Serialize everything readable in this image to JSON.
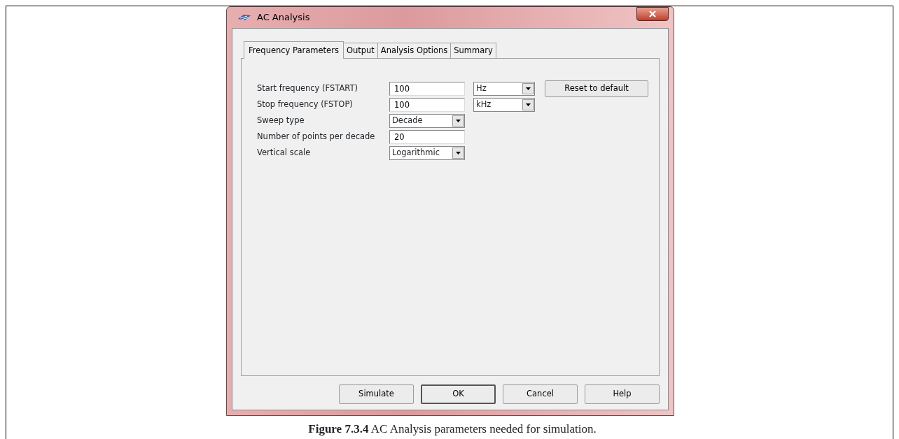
{
  "window": {
    "title": "AC Analysis"
  },
  "tabs": [
    {
      "label": "Frequency Parameters",
      "selected": true
    },
    {
      "label": "Output",
      "selected": false
    },
    {
      "label": "Analysis Options",
      "selected": false
    },
    {
      "label": "Summary",
      "selected": false
    }
  ],
  "parameters": [
    {
      "label": "Start frequency (FSTART)",
      "kind": "text",
      "value": "100",
      "unit": "Hz"
    },
    {
      "label": "Stop frequency (FSTOP)",
      "kind": "text",
      "value": "100",
      "unit": "kHz"
    },
    {
      "label": "Sweep type",
      "kind": "select",
      "value": "Decade"
    },
    {
      "label": "Number of points per decade",
      "kind": "text",
      "value": "20"
    },
    {
      "label": "Vertical scale",
      "kind": "select",
      "value": "Logarithmic"
    }
  ],
  "reset_button": "Reset to default",
  "buttons": [
    {
      "label": "Simulate",
      "default": false
    },
    {
      "label": "OK",
      "default": true
    },
    {
      "label": "Cancel",
      "default": false
    },
    {
      "label": "Help",
      "default": false
    }
  ],
  "caption": "**Figure 7.3.4**  AC Analysis parameters needed for simulation."
}
